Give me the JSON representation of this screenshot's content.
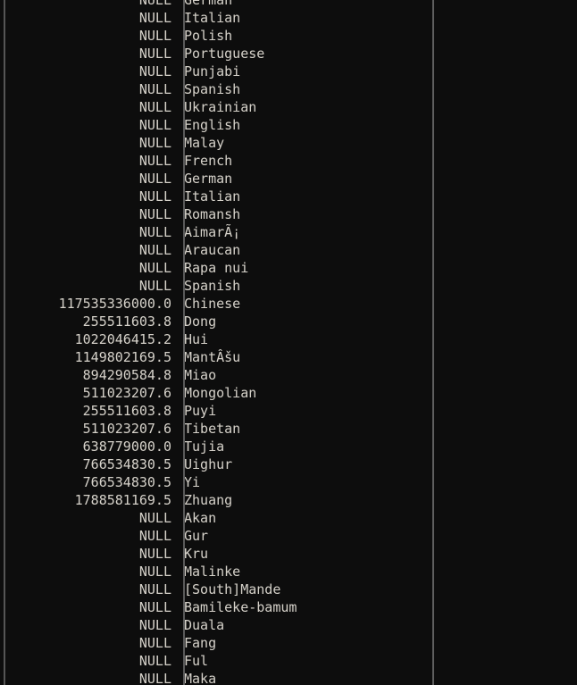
{
  "view": {
    "type": "sql-result-grid",
    "background_color": "#0d0d0d",
    "text_color": "#d6d2ca",
    "rule_color": "#555555",
    "null_label": "NULL"
  },
  "columns": [
    {
      "key": "value",
      "align": "right"
    },
    {
      "key": "language",
      "align": "left"
    }
  ],
  "rows": [
    {
      "value": "NULL",
      "language": "German"
    },
    {
      "value": "NULL",
      "language": "Italian"
    },
    {
      "value": "NULL",
      "language": "Polish"
    },
    {
      "value": "NULL",
      "language": "Portuguese"
    },
    {
      "value": "NULL",
      "language": "Punjabi"
    },
    {
      "value": "NULL",
      "language": "Spanish"
    },
    {
      "value": "NULL",
      "language": "Ukrainian"
    },
    {
      "value": "NULL",
      "language": "English"
    },
    {
      "value": "NULL",
      "language": "Malay"
    },
    {
      "value": "NULL",
      "language": "French"
    },
    {
      "value": "NULL",
      "language": "German"
    },
    {
      "value": "NULL",
      "language": "Italian"
    },
    {
      "value": "NULL",
      "language": "Romansh"
    },
    {
      "value": "NULL",
      "language": "AimarÃ¡"
    },
    {
      "value": "NULL",
      "language": "Araucan"
    },
    {
      "value": "NULL",
      "language": "Rapa nui"
    },
    {
      "value": "NULL",
      "language": "Spanish"
    },
    {
      "value": "117535336000.0",
      "language": "Chinese"
    },
    {
      "value": "255511603.8",
      "language": "Dong"
    },
    {
      "value": "1022046415.2",
      "language": "Hui"
    },
    {
      "value": "1149802169.5",
      "language": "MantÂšu"
    },
    {
      "value": "894290584.8",
      "language": "Miao"
    },
    {
      "value": "511023207.6",
      "language": "Mongolian"
    },
    {
      "value": "255511603.8",
      "language": "Puyi"
    },
    {
      "value": "511023207.6",
      "language": "Tibetan"
    },
    {
      "value": "638779000.0",
      "language": "Tujia"
    },
    {
      "value": "766534830.5",
      "language": "Uighur"
    },
    {
      "value": "766534830.5",
      "language": "Yi"
    },
    {
      "value": "1788581169.5",
      "language": "Zhuang"
    },
    {
      "value": "NULL",
      "language": "Akan"
    },
    {
      "value": "NULL",
      "language": "Gur"
    },
    {
      "value": "NULL",
      "language": "Kru"
    },
    {
      "value": "NULL",
      "language": "Malinke"
    },
    {
      "value": "NULL",
      "language": "[South]Mande"
    },
    {
      "value": "NULL",
      "language": "Bamileke-bamum"
    },
    {
      "value": "NULL",
      "language": "Duala"
    },
    {
      "value": "NULL",
      "language": "Fang"
    },
    {
      "value": "NULL",
      "language": "Ful"
    },
    {
      "value": "NULL",
      "language": "Maka"
    }
  ]
}
